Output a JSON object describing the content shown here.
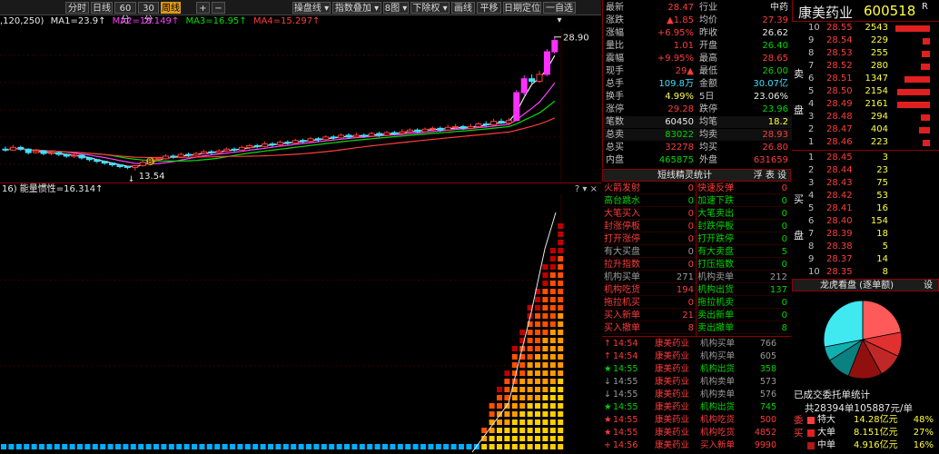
{
  "toolbar": {
    "buttons": [
      {
        "label": "分时",
        "active": false
      },
      {
        "label": "日线",
        "active": false
      },
      {
        "label": "60分",
        "active": false
      },
      {
        "label": "30分",
        "active": false
      },
      {
        "label": "周线",
        "active": true
      },
      {
        "label": "+",
        "active": false
      },
      {
        "label": "−",
        "active": false
      },
      {
        "label": "操盘线 ▾",
        "active": false
      },
      {
        "label": "指数叠加 ▾",
        "active": false
      },
      {
        "label": "8图 ▾",
        "active": false
      },
      {
        "label": "下除权 ▾",
        "active": false
      },
      {
        "label": "画线",
        "active": false
      },
      {
        "label": "平移",
        "active": false
      },
      {
        "label": "日期定位",
        "active": false
      },
      {
        "label": "一自选 ▾",
        "active": false
      }
    ]
  },
  "ma_line": {
    "prefix": ",120,250)",
    "items": [
      {
        "text": "MA1=23.9↑",
        "color": "#e8e8e8"
      },
      {
        "text": "MA2=18.149↑",
        "color": "#ff40ff"
      },
      {
        "text": "MA3=16.95↑",
        "color": "#00e000"
      },
      {
        "text": "MA4=15.297↑",
        "color": "#ff3c3c"
      }
    ]
  },
  "kline": {
    "high_label": "28.90",
    "low_label": "13.54",
    "marker_label": "B",
    "candles": [
      {
        "o": 16.0,
        "c": 15.9,
        "h": 16.3,
        "l": 15.7
      },
      {
        "o": 15.9,
        "c": 16.2,
        "h": 16.5,
        "l": 15.8
      },
      {
        "o": 16.2,
        "c": 16.0,
        "h": 16.4,
        "l": 15.8
      },
      {
        "o": 16.0,
        "c": 15.6,
        "h": 16.1,
        "l": 15.4
      },
      {
        "o": 15.6,
        "c": 15.8,
        "h": 16.0,
        "l": 15.5
      },
      {
        "o": 15.8,
        "c": 15.5,
        "h": 15.9,
        "l": 15.3
      },
      {
        "o": 15.5,
        "c": 15.6,
        "h": 15.8,
        "l": 15.3
      },
      {
        "o": 15.6,
        "c": 15.4,
        "h": 15.7,
        "l": 15.2
      },
      {
        "o": 15.4,
        "c": 15.2,
        "h": 15.5,
        "l": 15.0
      },
      {
        "o": 15.2,
        "c": 15.3,
        "h": 15.5,
        "l": 15.0
      },
      {
        "o": 15.3,
        "c": 15.0,
        "h": 15.4,
        "l": 14.8
      },
      {
        "o": 15.0,
        "c": 14.8,
        "h": 15.1,
        "l": 14.6
      },
      {
        "o": 14.8,
        "c": 14.6,
        "h": 14.9,
        "l": 14.4
      },
      {
        "o": 14.6,
        "c": 14.4,
        "h": 14.7,
        "l": 14.2
      },
      {
        "o": 14.4,
        "c": 14.2,
        "h": 14.5,
        "l": 14.0
      },
      {
        "o": 14.2,
        "c": 14.0,
        "h": 14.3,
        "l": 13.8
      },
      {
        "o": 14.0,
        "c": 13.9,
        "h": 14.1,
        "l": 13.7
      },
      {
        "o": 13.9,
        "c": 14.1,
        "h": 14.2,
        "l": 13.54
      },
      {
        "o": 14.1,
        "c": 14.5,
        "h": 14.7,
        "l": 14.0
      },
      {
        "o": 14.5,
        "c": 14.8,
        "h": 15.0,
        "l": 14.4
      },
      {
        "o": 14.8,
        "c": 14.9,
        "h": 15.1,
        "l": 14.6
      },
      {
        "o": 14.9,
        "c": 15.2,
        "h": 15.4,
        "l": 14.8
      },
      {
        "o": 15.2,
        "c": 15.1,
        "h": 15.4,
        "l": 14.9
      },
      {
        "o": 15.1,
        "c": 15.4,
        "h": 15.6,
        "l": 15.0
      },
      {
        "o": 15.4,
        "c": 15.3,
        "h": 15.6,
        "l": 15.1
      },
      {
        "o": 15.3,
        "c": 15.5,
        "h": 15.7,
        "l": 15.2
      },
      {
        "o": 15.5,
        "c": 15.7,
        "h": 15.9,
        "l": 15.4
      },
      {
        "o": 15.7,
        "c": 15.6,
        "h": 15.9,
        "l": 15.4
      },
      {
        "o": 15.6,
        "c": 15.8,
        "h": 16.0,
        "l": 15.5
      },
      {
        "o": 15.8,
        "c": 16.0,
        "h": 16.2,
        "l": 15.7
      },
      {
        "o": 16.0,
        "c": 15.9,
        "h": 16.2,
        "l": 15.7
      },
      {
        "o": 15.9,
        "c": 16.2,
        "h": 16.4,
        "l": 15.8
      },
      {
        "o": 16.2,
        "c": 16.4,
        "h": 16.6,
        "l": 16.0
      },
      {
        "o": 16.4,
        "c": 16.3,
        "h": 16.6,
        "l": 16.1
      },
      {
        "o": 16.3,
        "c": 16.6,
        "h": 16.9,
        "l": 16.2
      },
      {
        "o": 16.6,
        "c": 16.5,
        "h": 16.8,
        "l": 16.3
      },
      {
        "o": 16.5,
        "c": 16.8,
        "h": 17.0,
        "l": 16.4
      },
      {
        "o": 16.8,
        "c": 16.7,
        "h": 17.0,
        "l": 16.5
      },
      {
        "o": 16.7,
        "c": 17.0,
        "h": 17.2,
        "l": 16.6
      },
      {
        "o": 17.0,
        "c": 16.9,
        "h": 17.2,
        "l": 16.7
      },
      {
        "o": 16.9,
        "c": 17.2,
        "h": 17.4,
        "l": 16.8
      },
      {
        "o": 17.2,
        "c": 17.1,
        "h": 17.4,
        "l": 16.9
      },
      {
        "o": 17.1,
        "c": 17.4,
        "h": 17.6,
        "l": 17.0
      },
      {
        "o": 17.4,
        "c": 17.3,
        "h": 17.6,
        "l": 17.1
      },
      {
        "o": 17.3,
        "c": 17.6,
        "h": 17.8,
        "l": 17.2
      },
      {
        "o": 17.6,
        "c": 17.4,
        "h": 17.8,
        "l": 17.2
      },
      {
        "o": 17.4,
        "c": 17.6,
        "h": 17.9,
        "l": 17.3
      },
      {
        "o": 17.6,
        "c": 17.5,
        "h": 17.8,
        "l": 17.3
      },
      {
        "o": 17.5,
        "c": 17.8,
        "h": 18.0,
        "l": 17.4
      },
      {
        "o": 17.8,
        "c": 17.6,
        "h": 18.0,
        "l": 17.4
      },
      {
        "o": 17.6,
        "c": 17.9,
        "h": 18.1,
        "l": 17.5
      },
      {
        "o": 17.9,
        "c": 17.8,
        "h": 18.1,
        "l": 17.6
      },
      {
        "o": 17.8,
        "c": 18.0,
        "h": 18.3,
        "l": 17.7
      },
      {
        "o": 18.0,
        "c": 18.2,
        "h": 18.4,
        "l": 17.9
      },
      {
        "o": 18.2,
        "c": 18.0,
        "h": 18.4,
        "l": 17.8
      },
      {
        "o": 18.0,
        "c": 18.3,
        "h": 18.5,
        "l": 17.9
      },
      {
        "o": 18.3,
        "c": 18.4,
        "h": 18.6,
        "l": 18.1
      },
      {
        "o": 18.4,
        "c": 18.2,
        "h": 18.6,
        "l": 18.0
      },
      {
        "o": 18.2,
        "c": 18.5,
        "h": 18.8,
        "l": 18.1
      },
      {
        "o": 18.5,
        "c": 18.6,
        "h": 18.9,
        "l": 18.3
      },
      {
        "o": 18.6,
        "c": 18.4,
        "h": 18.8,
        "l": 18.2
      },
      {
        "o": 18.4,
        "c": 18.6,
        "h": 18.9,
        "l": 18.3
      },
      {
        "o": 18.6,
        "c": 18.9,
        "h": 19.1,
        "l": 18.5
      },
      {
        "o": 18.9,
        "c": 18.8,
        "h": 19.2,
        "l": 18.6
      },
      {
        "o": 18.8,
        "c": 19.2,
        "h": 19.5,
        "l": 18.7
      },
      {
        "o": 19.2,
        "c": 19.0,
        "h": 19.5,
        "l": 18.9
      },
      {
        "o": 19.0,
        "c": 19.3,
        "h": 19.6,
        "l": 18.9
      },
      {
        "o": 19.3,
        "c": 22.5,
        "h": 22.8,
        "l": 19.2
      },
      {
        "o": 22.5,
        "c": 24.1,
        "h": 24.5,
        "l": 22.2
      },
      {
        "o": 24.1,
        "c": 23.8,
        "h": 24.6,
        "l": 23.3
      },
      {
        "o": 23.8,
        "c": 24.6,
        "h": 25.0,
        "l": 23.6
      },
      {
        "o": 24.6,
        "c": 27.2,
        "h": 27.5,
        "l": 24.4
      },
      {
        "o": 27.2,
        "c": 28.5,
        "h": 28.9,
        "l": 27.0
      }
    ]
  },
  "energy": {
    "title": "16)  能量惯性=16.314↑",
    "controls": "? ▾ ×"
  },
  "quote": {
    "rows": [
      {
        "l1": "最新",
        "v1": "28.47",
        "c1": "red",
        "l2": "行业",
        "v2": "中药",
        "c2": "white"
      },
      {
        "l1": "涨跌",
        "v1": "▲1.85",
        "c1": "red",
        "l2": "均价",
        "v2": "27.39",
        "c2": "red"
      },
      {
        "l1": "涨幅",
        "v1": "+6.95%",
        "c1": "red",
        "l2": "昨收",
        "v2": "26.62",
        "c2": "white"
      },
      {
        "l1": "量比",
        "v1": "1.01",
        "c1": "red",
        "l2": "开盘",
        "v2": "26.40",
        "c2": "green"
      },
      {
        "l1": "震幅",
        "v1": "+9.95%",
        "c1": "red",
        "l2": "最高",
        "v2": "28.65",
        "c2": "red"
      },
      {
        "l1": "现手",
        "v1": "29▲",
        "c1": "red",
        "l2": "最低",
        "v2": "26.00",
        "c2": "green"
      },
      {
        "l1": "总手",
        "v1": "109.8万",
        "c1": "cyan",
        "l2": "金额",
        "v2": "30.07亿",
        "c2": "cyan"
      },
      {
        "l1": "换手",
        "v1": "4.99%",
        "c1": "yellow",
        "l2": "5日",
        "v2": "23.06%",
        "c2": "white"
      },
      {
        "l1": "涨停",
        "v1": "29.28",
        "c1": "red",
        "l2": "跌停",
        "v2": "23.96",
        "c2": "green"
      },
      {
        "l1": "笔数",
        "v1": "60450",
        "c1": "white",
        "l2": "均笔",
        "v2": "18.2",
        "c2": "yellow"
      },
      {
        "l1": "总卖",
        "v1": "83022",
        "c1": "green",
        "l2": "均卖",
        "v2": "28.93",
        "c2": "red"
      },
      {
        "l1": "总买",
        "v1": "32278",
        "c1": "red",
        "l2": "均买",
        "v2": "26.80",
        "c2": "red"
      },
      {
        "l1": "内盘",
        "v1": "465875",
        "c1": "green",
        "l2": "外盘",
        "v2": "631659",
        "c2": "red"
      }
    ]
  },
  "stats": {
    "title": "短线精灵统计",
    "tabs": "浮 表 设",
    "rows": [
      {
        "l": "火箭发射",
        "lc": "red",
        "lv": "0",
        "r": "快速反弹",
        "rc": "red",
        "rv": "0"
      },
      {
        "l": "高台跳水",
        "lc": "green",
        "lv": "0",
        "r": "加速下跌",
        "rc": "green",
        "rv": "0"
      },
      {
        "l": "大笔买入",
        "lc": "red",
        "lv": "0",
        "r": "大笔卖出",
        "rc": "green",
        "rv": "0"
      },
      {
        "l": "封涨停板",
        "lc": "red",
        "lv": "0",
        "r": "封跌停板",
        "rc": "green",
        "rv": "0"
      },
      {
        "l": "打开涨停",
        "lc": "red",
        "lv": "0",
        "r": "打开跌停",
        "rc": "green",
        "rv": "0"
      },
      {
        "l": "有大买盘",
        "lc": "gray",
        "lv": "0",
        "r": "有大卖盘",
        "rc": "green",
        "rv": "5"
      },
      {
        "l": "拉升指数",
        "lc": "red",
        "lv": "0",
        "r": "打压指数",
        "rc": "green",
        "rv": "0"
      },
      {
        "l": "机构买单",
        "lc": "gray",
        "lv": "271",
        "r": "机构卖单",
        "rc": "gray",
        "rv": "212"
      },
      {
        "l": "机构吃货",
        "lc": "red",
        "lv": "194",
        "r": "机构出货",
        "rc": "green",
        "rv": "137"
      },
      {
        "l": "拖拉机买",
        "lc": "red",
        "lv": "0",
        "r": "拖拉机卖",
        "rc": "green",
        "rv": "0"
      },
      {
        "l": "买入新单",
        "lc": "red",
        "lv": "21",
        "r": "卖出新单",
        "rc": "green",
        "rv": "0"
      },
      {
        "l": "买入撤单",
        "lc": "red",
        "lv": "8",
        "r": "卖出撤单",
        "rc": "green",
        "rv": "8"
      }
    ]
  },
  "trades": [
    {
      "arrow": "↑",
      "time": "14:54",
      "tc": "red",
      "name": "康美药业",
      "act": "机构买单",
      "ac": "gray",
      "v": "766"
    },
    {
      "arrow": "↑",
      "time": "14:54",
      "tc": "red",
      "name": "康美药业",
      "act": "机构买单",
      "ac": "gray",
      "v": "605"
    },
    {
      "arrow": "★",
      "time": "14:55",
      "tc": "green",
      "name": "康美药业",
      "act": "机构出货",
      "ac": "green",
      "v": "358"
    },
    {
      "arrow": "↓",
      "time": "14:55",
      "tc": "gray",
      "name": "康美药业",
      "act": "机构卖单",
      "ac": "gray",
      "v": "573"
    },
    {
      "arrow": "↓",
      "time": "14:55",
      "tc": "gray",
      "name": "康美药业",
      "act": "机构卖单",
      "ac": "gray",
      "v": "576"
    },
    {
      "arrow": "★",
      "time": "14:55",
      "tc": "green",
      "name": "康美药业",
      "act": "机构出货",
      "ac": "green",
      "v": "745"
    },
    {
      "arrow": "★",
      "time": "14:55",
      "tc": "red",
      "name": "康美药业",
      "act": "机构吃货",
      "ac": "red",
      "v": "500"
    },
    {
      "arrow": "★",
      "time": "14:55",
      "tc": "red",
      "name": "康美药业",
      "act": "机构吃货",
      "ac": "red",
      "v": "4852"
    },
    {
      "arrow": "+",
      "time": "14:56",
      "tc": "red",
      "name": "康美药业",
      "act": "买入新单",
      "ac": "red",
      "v": "9990"
    }
  ],
  "stock": {
    "name": "康美药业",
    "code": "600518",
    "flag": "R"
  },
  "order_book": {
    "sell_label": "卖盘",
    "buy_label": "买盘",
    "sell": [
      {
        "lvl": "10",
        "price": "28.55",
        "vol": "2543",
        "bar": 0.95
      },
      {
        "lvl": "9",
        "price": "28.54",
        "vol": "229",
        "bar": 0.2
      },
      {
        "lvl": "8",
        "price": "28.53",
        "vol": "255",
        "bar": 0.22
      },
      {
        "lvl": "7",
        "price": "28.52",
        "vol": "280",
        "bar": 0.24
      },
      {
        "lvl": "6",
        "price": "28.51",
        "vol": "1347",
        "bar": 0.7
      },
      {
        "lvl": "5",
        "price": "28.50",
        "vol": "2154",
        "bar": 0.9
      },
      {
        "lvl": "4",
        "price": "28.49",
        "vol": "2161",
        "bar": 0.9
      },
      {
        "lvl": "3",
        "price": "28.48",
        "vol": "294",
        "bar": 0.25
      },
      {
        "lvl": "2",
        "price": "28.47",
        "vol": "404",
        "bar": 0.3
      },
      {
        "lvl": "1",
        "price": "28.46",
        "vol": "223",
        "bar": 0.2
      }
    ],
    "buy": [
      {
        "lvl": "1",
        "price": "28.45",
        "vol": "3"
      },
      {
        "lvl": "2",
        "price": "28.44",
        "vol": "23"
      },
      {
        "lvl": "3",
        "price": "28.43",
        "vol": "75"
      },
      {
        "lvl": "4",
        "price": "28.42",
        "vol": "53"
      },
      {
        "lvl": "5",
        "price": "28.41",
        "vol": "16"
      },
      {
        "lvl": "6",
        "price": "28.40",
        "vol": "154"
      },
      {
        "lvl": "7",
        "price": "28.39",
        "vol": "18"
      },
      {
        "lvl": "8",
        "price": "28.38",
        "vol": "5"
      },
      {
        "lvl": "9",
        "price": "28.37",
        "vol": "14"
      },
      {
        "lvl": "10",
        "price": "28.35",
        "vol": "8"
      }
    ]
  },
  "dragon": {
    "title": "龙虎看盘 (逐单额)",
    "settings": "设",
    "pie_slices": [
      0.22,
      0.1,
      0.1,
      0.14,
      0.1,
      0.06,
      0.28
    ],
    "pie_colors": [
      "#ff5a5a",
      "#e03030",
      "#c02828",
      "#901010",
      "#0a8080",
      "#10b0b0",
      "#40e8f0"
    ],
    "summary_title": "已成交委托单统计",
    "total": "共28394单105887元/单",
    "side_label": "委买",
    "rows": [
      {
        "name": "特大",
        "amount": "14.28亿元",
        "pct": "48%"
      },
      {
        "name": "大单",
        "amount": "8.151亿元",
        "pct": "27%"
      },
      {
        "name": "中单",
        "amount": "4.916亿元",
        "pct": "16%"
      }
    ]
  }
}
